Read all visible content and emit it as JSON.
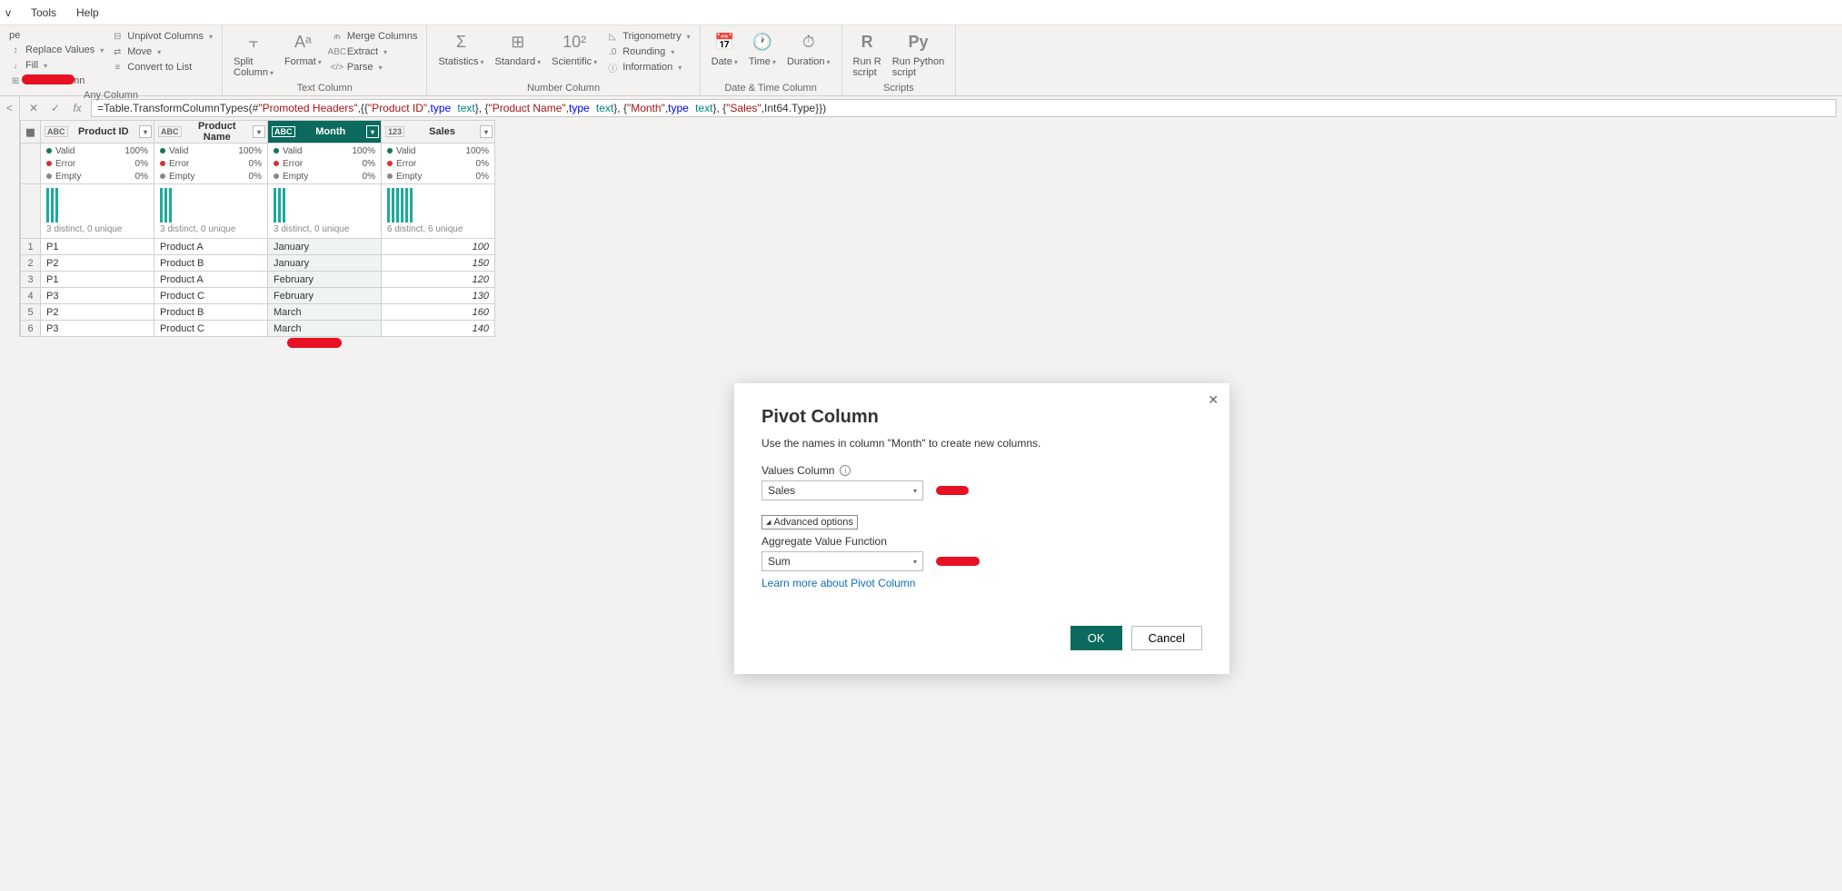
{
  "menubar": {
    "view": "v",
    "tools": "Tools",
    "help": "Help"
  },
  "ribbon": {
    "anyColumn": {
      "title": "Any Column",
      "pe": "pe",
      "replaceValues": "Replace Values",
      "fill": "Fill",
      "pivotColumn": "Pivot Column",
      "unpivot": "Unpivot Columns",
      "move": "Move",
      "convertToList": "Convert to List"
    },
    "textColumn": {
      "title": "Text Column",
      "split": "Split\nColumn",
      "format": "Format",
      "merge": "Merge Columns",
      "extract": "Extract",
      "parse": "Parse"
    },
    "numberColumn": {
      "title": "Number Column",
      "statistics": "Statistics",
      "standard": "Standard",
      "scientific": "Scientific",
      "trig": "Trigonometry",
      "rounding": "Rounding",
      "info": "Information"
    },
    "dateTime": {
      "title": "Date & Time Column",
      "date": "Date",
      "time": "Time",
      "duration": "Duration"
    },
    "scripts": {
      "title": "Scripts",
      "r": "Run R\nscript",
      "py": "Run Python\nscript"
    }
  },
  "formula": {
    "prefix": "= ",
    "fn": "Table.TransformColumnTypes",
    "open": "(#",
    "arg1": "\"Promoted Headers\"",
    "mid1": ",{{",
    "c1": "\"Product ID\"",
    "sep": ", ",
    "kw_type": "type",
    "t_text": "text",
    "mid2": "}, {",
    "c2": "\"Product Name\"",
    "c3": "\"Month\"",
    "c4": "\"Sales\"",
    "int64": "Int64.Type",
    "close": "}})"
  },
  "columns": [
    {
      "name": "Product ID",
      "type": "ABC",
      "stats": "3 distinct, 0 unique",
      "bars": [
        38,
        38,
        38
      ],
      "selected": false
    },
    {
      "name": "Product Name",
      "type": "ABC",
      "stats": "3 distinct, 0 unique",
      "bars": [
        38,
        38,
        38
      ],
      "selected": false
    },
    {
      "name": "Month",
      "type": "ABC",
      "stats": "3 distinct, 0 unique",
      "bars": [
        38,
        38,
        38
      ],
      "selected": true
    },
    {
      "name": "Sales",
      "type": "123",
      "stats": "6 distinct, 6 unique",
      "bars": [
        38,
        38,
        38,
        38,
        38,
        38
      ],
      "selected": false
    }
  ],
  "quality": {
    "valid": "Valid",
    "validPct": "100%",
    "error": "Error",
    "errorPct": "0%",
    "empty": "Empty",
    "emptyPct": "0%"
  },
  "rows": [
    {
      "n": "1",
      "pid": "P1",
      "pname": "Product A",
      "month": "January",
      "sales": "100"
    },
    {
      "n": "2",
      "pid": "P2",
      "pname": "Product B",
      "month": "January",
      "sales": "150"
    },
    {
      "n": "3",
      "pid": "P1",
      "pname": "Product A",
      "month": "February",
      "sales": "120"
    },
    {
      "n": "4",
      "pid": "P3",
      "pname": "Product C",
      "month": "February",
      "sales": "130"
    },
    {
      "n": "5",
      "pid": "P2",
      "pname": "Product B",
      "month": "March",
      "sales": "160"
    },
    {
      "n": "6",
      "pid": "P3",
      "pname": "Product C",
      "month": "March",
      "sales": "140"
    }
  ],
  "dialog": {
    "title": "Pivot Column",
    "desc": "Use the names in column \"Month\" to create new columns.",
    "valuesLabel": "Values Column",
    "valuesValue": "Sales",
    "advToggle": "Advanced options",
    "aggLabel": "Aggregate Value Function",
    "aggValue": "Sum",
    "learnMore": "Learn more about Pivot Column",
    "ok": "OK",
    "cancel": "Cancel"
  }
}
